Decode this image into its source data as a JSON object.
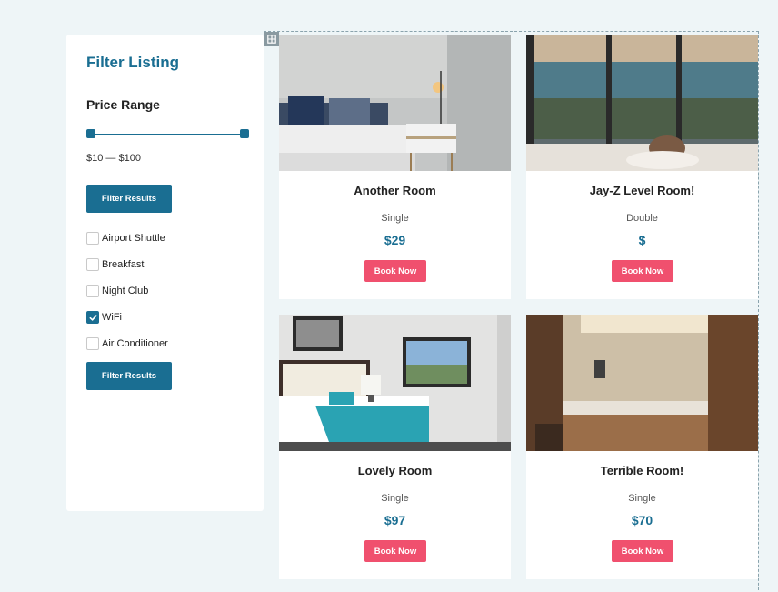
{
  "sidebar": {
    "title": "Filter Listing",
    "price_heading": "Price Range",
    "price_display": "$10 — $100",
    "filter_button_label": "Filter Results",
    "amenities": [
      {
        "label": "Airport Shuttle",
        "checked": false
      },
      {
        "label": "Breakfast",
        "checked": false
      },
      {
        "label": "Night Club",
        "checked": false
      },
      {
        "label": "WiFi",
        "checked": true
      },
      {
        "label": "Air Conditioner",
        "checked": false
      }
    ]
  },
  "rooms": [
    {
      "title": "Another Room",
      "type": "Single",
      "price": "$29",
      "book_label": "Book Now"
    },
    {
      "title": "Jay-Z Level Room!",
      "type": "Double",
      "price": "$",
      "book_label": "Book Now"
    },
    {
      "title": "Lovely Room",
      "type": "Single",
      "price": "$97",
      "book_label": "Book Now"
    },
    {
      "title": "Terrible Room!",
      "type": "Single",
      "price": "$70",
      "book_label": "Book Now"
    }
  ],
  "colors": {
    "accent": "#1a6e92",
    "book_button": "#f0506e",
    "background": "#eef5f7"
  }
}
